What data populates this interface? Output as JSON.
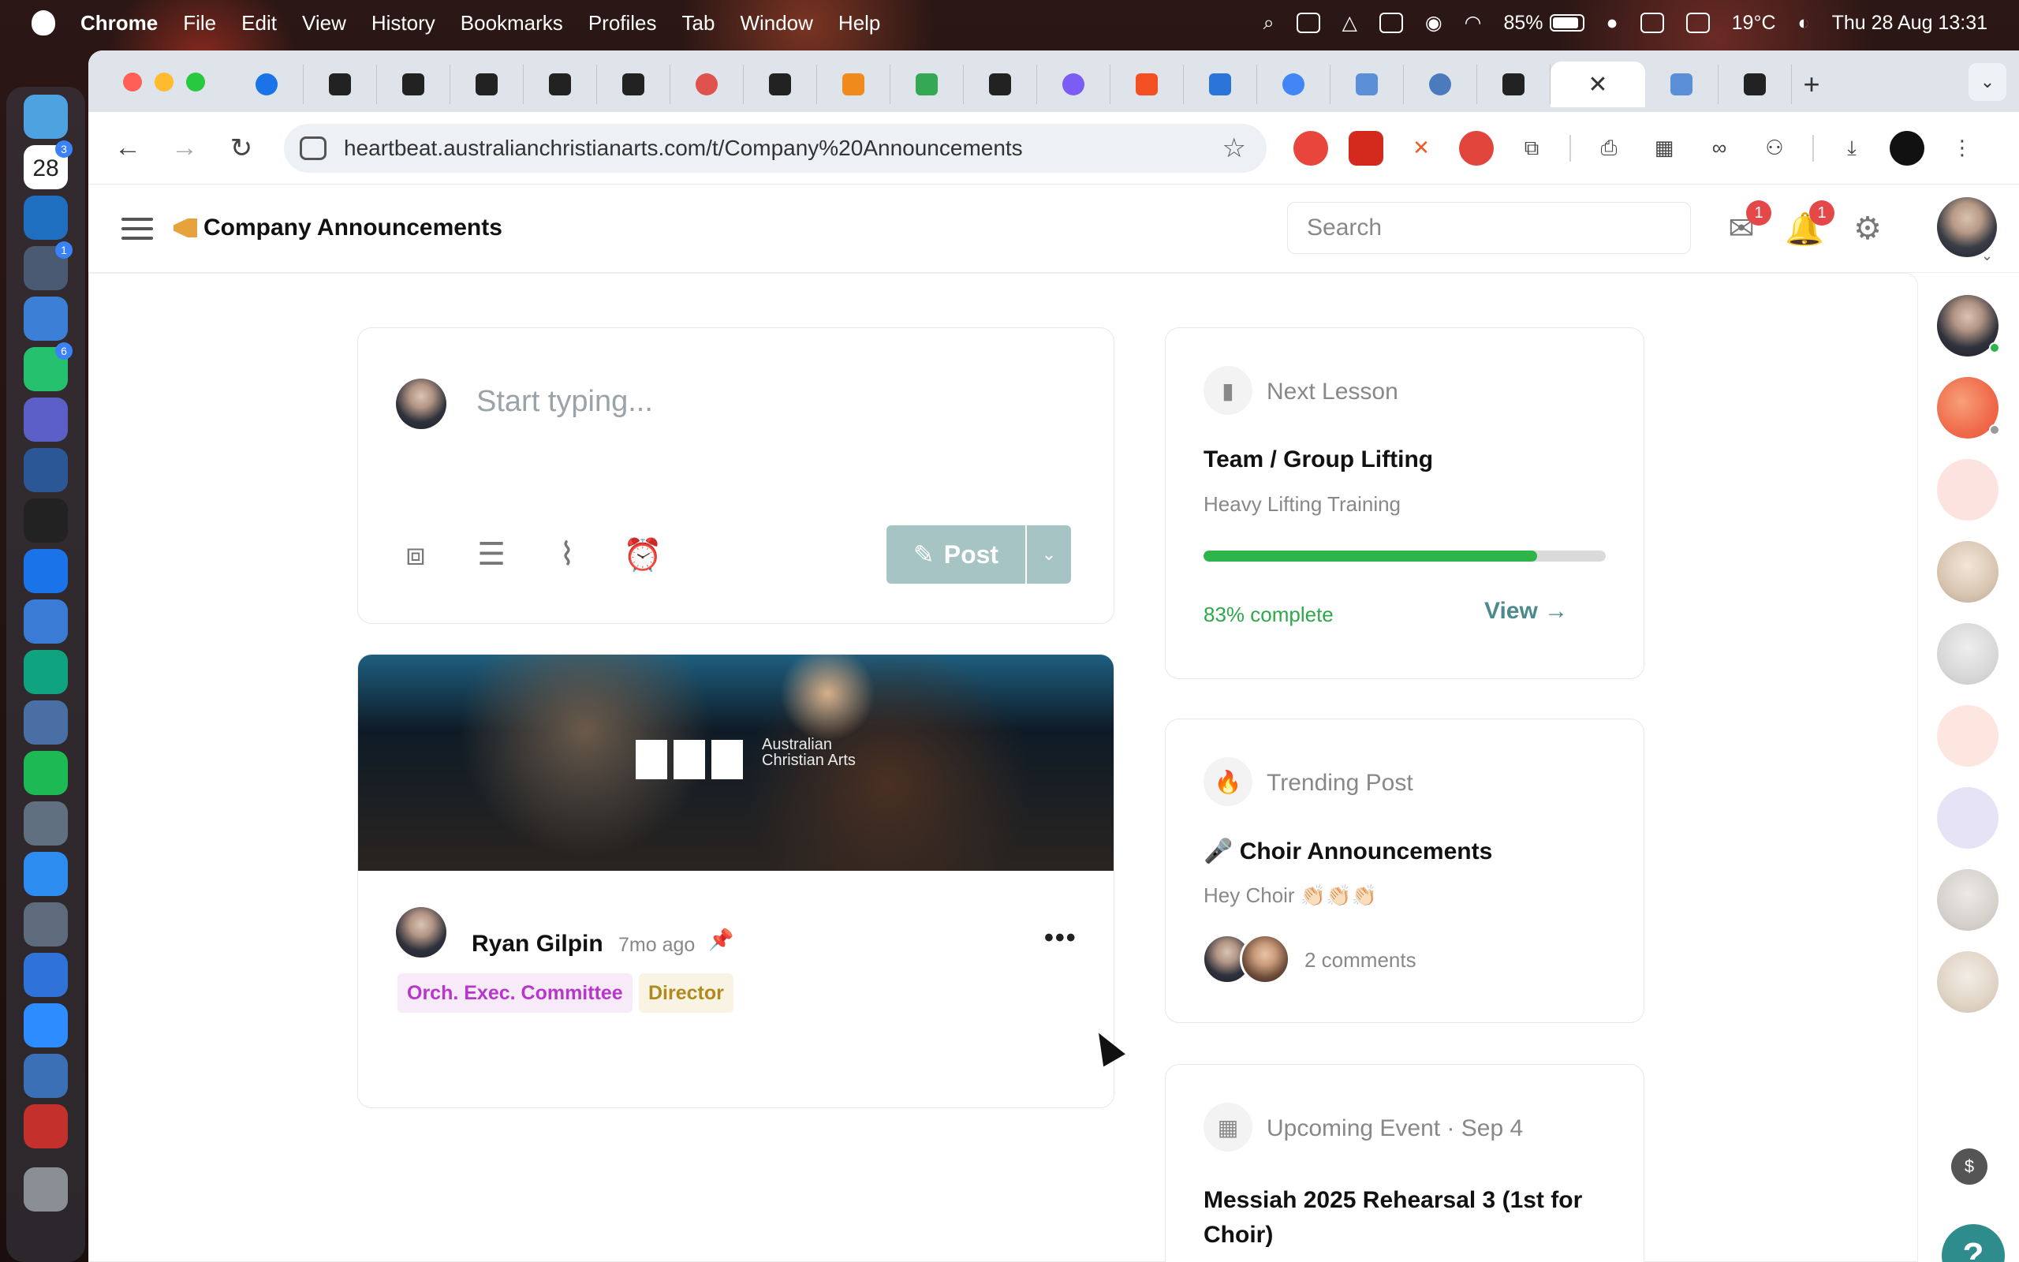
{
  "menubar": {
    "app": "Chrome",
    "items": [
      "File",
      "Edit",
      "View",
      "History",
      "Bookmarks",
      "Profiles",
      "Tab",
      "Window",
      "Help"
    ],
    "battery": "85%",
    "weather": "19°C",
    "datetime": "Thu 28 Aug 13:31"
  },
  "dock": {
    "calendar_day": "28",
    "badges": [
      "3",
      "1",
      "6"
    ]
  },
  "browser": {
    "url": "heartbeat.australianchristianarts.com/t/Company%20Announcements",
    "active_tab_close": "✕",
    "new_tab": "+"
  },
  "header": {
    "title": "Company Announcements",
    "search_placeholder": "Search",
    "inbox_badge": "1",
    "notifications_badge": "1"
  },
  "composer": {
    "placeholder": "Start typing...",
    "post_label": "Post"
  },
  "post": {
    "banner_text": "Australian Christian Arts",
    "author": "Ryan Gilpin",
    "time_ago": "7mo ago",
    "tags": [
      "Orch. Exec. Committee",
      "Director"
    ]
  },
  "next_lesson": {
    "label": "Next Lesson",
    "title": "Team / Group Lifting",
    "subtitle": "Heavy Lifting Training",
    "progress_percent": 83,
    "progress_text": "83% complete",
    "view_label": "View →"
  },
  "trending": {
    "label": "Trending Post",
    "title": "🎤 Choir Announcements",
    "subtitle": "Hey Choir 👏🏻👏🏻👏🏻",
    "comments": "2 comments"
  },
  "event": {
    "label": "Upcoming Event · Sep 4",
    "title": "Messiah 2025 Rehearsal 3 (1st for Choir)"
  },
  "colors": {
    "accent": "#2e8c8c",
    "progress": "#2eb54a",
    "tag_purple": "#b637c9",
    "tag_gold": "#b08a1e",
    "badge": "#e54848"
  }
}
